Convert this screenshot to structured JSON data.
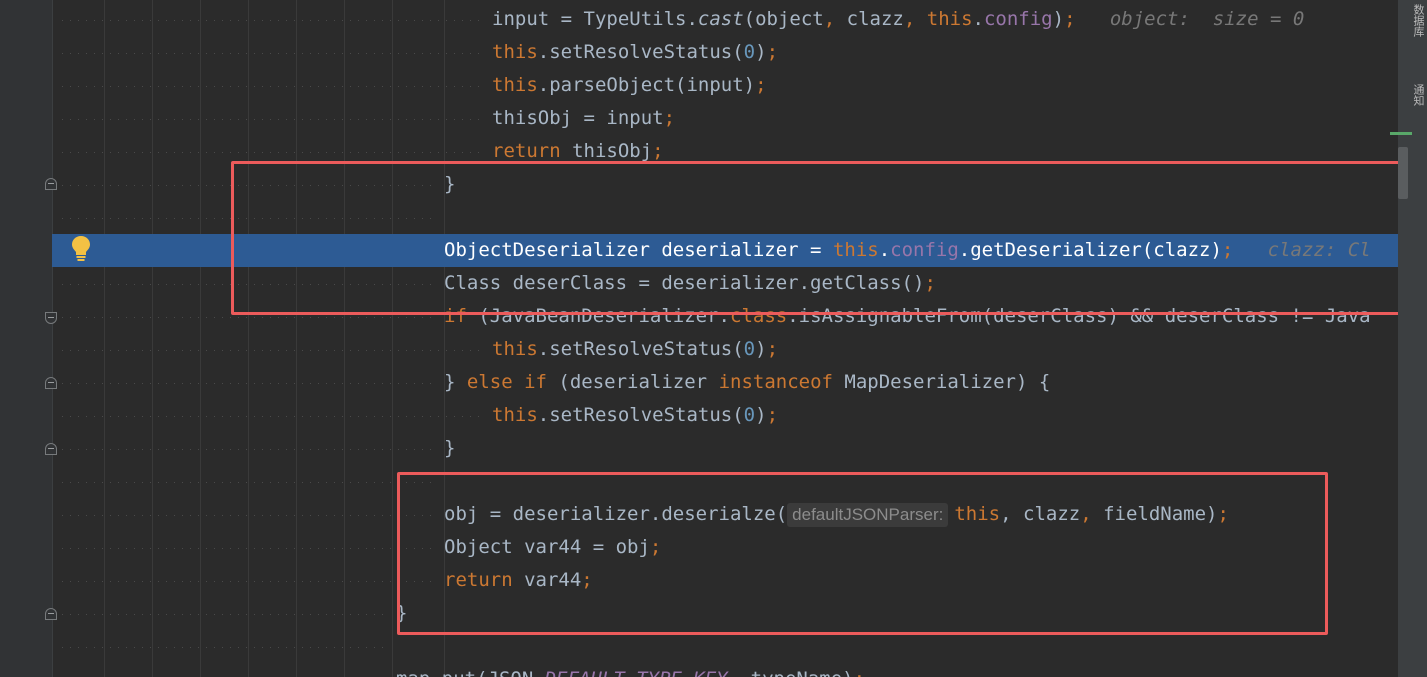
{
  "editor": {
    "lines": [
      {
        "id": "l1",
        "segments": [
          {
            "t": "input = TypeUtils."
          },
          {
            "t": "cast",
            "c": "it"
          },
          {
            "t": "(object"
          },
          {
            "t": ",",
            "c": "kw"
          },
          {
            "t": " clazz"
          },
          {
            "t": ",",
            "c": "kw"
          },
          {
            "t": " "
          },
          {
            "t": "this",
            "c": "kw"
          },
          {
            "t": "."
          },
          {
            "t": "config",
            "c": "fld"
          },
          {
            "t": ")"
          },
          {
            "t": ";",
            "c": "kw"
          },
          {
            "t": "   object:  size = 0",
            "c": "hint"
          }
        ]
      },
      {
        "id": "l2",
        "segments": [
          {
            "t": "this",
            "c": "kw"
          },
          {
            "t": ".setResolveStatus("
          },
          {
            "t": "0",
            "c": "num"
          },
          {
            "t": ")"
          },
          {
            "t": ";",
            "c": "kw"
          }
        ]
      },
      {
        "id": "l3",
        "segments": [
          {
            "t": "this",
            "c": "kw"
          },
          {
            "t": ".parseObject(input)"
          },
          {
            "t": ";",
            "c": "kw"
          }
        ]
      },
      {
        "id": "l4",
        "segments": [
          {
            "t": "thisObj = input"
          },
          {
            "t": ";",
            "c": "kw"
          }
        ]
      },
      {
        "id": "l5",
        "segments": [
          {
            "t": "return",
            "c": "kw"
          },
          {
            "t": " thisObj"
          },
          {
            "t": ";",
            "c": "kw"
          }
        ]
      },
      {
        "id": "l6",
        "segments": [
          {
            "t": "}"
          }
        ]
      },
      {
        "id": "l7",
        "segments": []
      },
      {
        "id": "l8",
        "segments": [
          {
            "t": "ObjectDeserializer deserializer = "
          },
          {
            "t": "this",
            "c": "kw"
          },
          {
            "t": "."
          },
          {
            "t": "config",
            "c": "fld"
          },
          {
            "t": ".getDeserializer(clazz)"
          },
          {
            "t": ";",
            "c": "kw"
          },
          {
            "t": "   clazz: Cl",
            "c": "hint"
          }
        ]
      },
      {
        "id": "l9",
        "segments": [
          {
            "t": "Class deserClass = deserializer.getClass()"
          },
          {
            "t": ";",
            "c": "kw"
          }
        ]
      },
      {
        "id": "l10",
        "segments": [
          {
            "t": "if",
            "c": "kw"
          },
          {
            "t": " (JavaBeanDeserializer."
          },
          {
            "t": "class",
            "c": "kw"
          },
          {
            "t": ".isAssignableFrom(deserClass) && deserClass != Java"
          }
        ]
      },
      {
        "id": "l11",
        "segments": [
          {
            "t": "this",
            "c": "kw"
          },
          {
            "t": ".setResolveStatus("
          },
          {
            "t": "0",
            "c": "num"
          },
          {
            "t": ")"
          },
          {
            "t": ";",
            "c": "kw"
          }
        ]
      },
      {
        "id": "l12",
        "segments": [
          {
            "t": "} "
          },
          {
            "t": "else if",
            "c": "kw"
          },
          {
            "t": " (deserializer "
          },
          {
            "t": "instanceof",
            "c": "kw"
          },
          {
            "t": " MapDeserializer) {"
          }
        ]
      },
      {
        "id": "l13",
        "segments": [
          {
            "t": "this",
            "c": "kw"
          },
          {
            "t": ".setResolveStatus("
          },
          {
            "t": "0",
            "c": "num"
          },
          {
            "t": ")"
          },
          {
            "t": ";",
            "c": "kw"
          }
        ]
      },
      {
        "id": "l14",
        "segments": [
          {
            "t": "}"
          }
        ]
      },
      {
        "id": "l15",
        "segments": []
      },
      {
        "id": "l16",
        "segments": [
          {
            "t": "obj = deserializer.deserialze("
          },
          {
            "t": "defaultJSONParser:",
            "c": "param"
          },
          {
            "t": "this",
            "c": "kw"
          },
          {
            "t": ","
          },
          {
            "t": " clazz"
          },
          {
            "t": ",",
            "c": "kw"
          },
          {
            "t": " fieldName)"
          },
          {
            "t": ";",
            "c": "kw"
          }
        ]
      },
      {
        "id": "l17",
        "segments": [
          {
            "t": "Object var44 = obj"
          },
          {
            "t": ";",
            "c": "kw"
          }
        ]
      },
      {
        "id": "l18",
        "segments": [
          {
            "t": "return",
            "c": "kw"
          },
          {
            "t": " var44"
          },
          {
            "t": ";",
            "c": "kw"
          }
        ]
      },
      {
        "id": "l19",
        "segments": [
          {
            "t": "}"
          }
        ]
      },
      {
        "id": "l20",
        "segments": []
      },
      {
        "id": "l21",
        "segments": [
          {
            "t": "map.put(JSON."
          },
          {
            "t": "DEFAULT_TYPE_KEY",
            "c": "fld it"
          },
          {
            "t": ", typeName)"
          },
          {
            "t": ";",
            "c": "kw"
          }
        ]
      }
    ]
  },
  "sidebar_right": {
    "label_top": "数据库",
    "label_mid": "通知"
  },
  "colors": {
    "exec_line": "#2d5b94",
    "highlight_box": "#ec5b5b",
    "background": "#2b2b2b"
  }
}
